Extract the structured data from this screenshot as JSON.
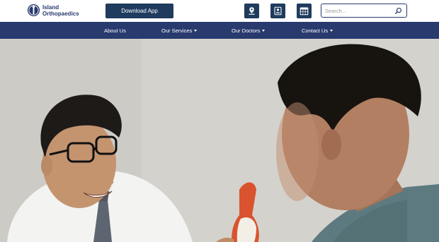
{
  "header": {
    "logo": {
      "line1": "Island",
      "line2": "Orthopaedics"
    },
    "download_label": "Download App",
    "icons": {
      "location": "location-pin-icon",
      "doctor": "doctor-id-icon",
      "calendar": "calendar-icon"
    },
    "search": {
      "placeholder": "Search...",
      "icon": "search-icon"
    }
  },
  "nav": {
    "items": [
      {
        "label": "About Us",
        "has_dropdown": false
      },
      {
        "label": "Our Services",
        "has_dropdown": true
      },
      {
        "label": "Our Doctors",
        "has_dropdown": true
      },
      {
        "label": "Contact Us",
        "has_dropdown": true
      }
    ]
  },
  "colors": {
    "brand_navy": "#283a6e",
    "button_dark": "#1f3b5e",
    "hero_background": "#d6d4cf"
  },
  "hero": {
    "image": "doctor-showing-knee-model-to-patient"
  }
}
